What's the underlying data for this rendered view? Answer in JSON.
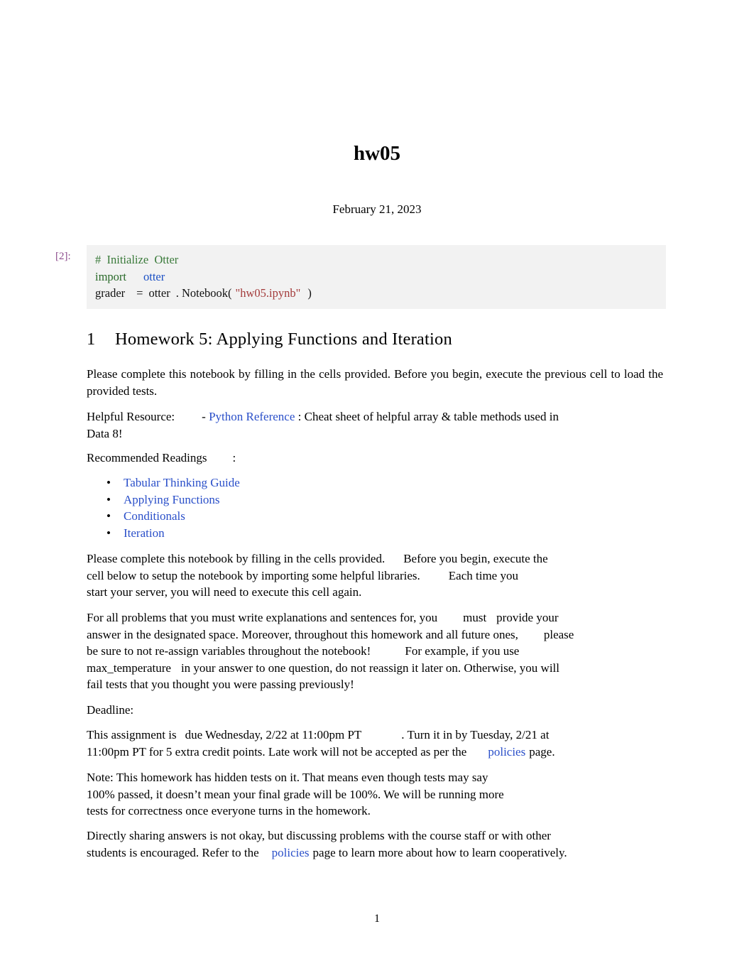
{
  "document": {
    "title": "hw05",
    "date": "February 21, 2023",
    "page_number": "1"
  },
  "code_cell": {
    "label": "[2]:",
    "lines": [
      {
        "comment": "#  Initialize  Otter"
      },
      {
        "kw": "import",
        "name": "otter"
      },
      {
        "plain1": "grader",
        "plain2": "=",
        "plain3": "otter",
        "plain4": ". Notebook(",
        "str": "\"hw05.ipynb\"",
        "plain5": ")"
      }
    ],
    "raw": "# Initialize Otter\nimport otter\ngrader = otter.Notebook(\"hw05.ipynb\")"
  },
  "section": {
    "number": "1",
    "heading": "Homework 5: Applying Functions and Iteration"
  },
  "paragraphs": {
    "p1": "Please complete this notebook by filling in the cells provided. Before you begin, execute the previous cell to load the provided tests.",
    "p2_lead": "Helpful  Resource:",
    "p2_dash": "-",
    "p2_link": "Python Reference",
    "p2_rest": ": Cheat sheet of helpful array & table methods used in",
    "p2_line2": "Data 8!",
    "p3_lead": "Recommended  Readings",
    "p3_colon": ":",
    "p4_line1": "Please  complete  this  notebook  by  filling  in  the  cells  provided.",
    "p4_line1b": "Before  you  begin,  execute  the",
    "p4_line2": "cell  below  to  setup  the  notebook  by  importing  some  helpful  libraries.",
    "p4_line2b": "Each  time  you",
    "p4_line3": "start your server, you will need to execute this cell again.",
    "p5_line1": "For  all  problems  that  you  must  write  explanations  and  sentences  for,  you",
    "p5_line1b": "must",
    "p5_line1c": "provide  your",
    "p5_line2": "answer in the designated space. Moreover, throughout this homework and all future ones,",
    "p5_line2b": "please",
    "p5_line3": "be  sure  to  not  re-assign  variables  throughout  the  notebook!",
    "p5_line3b": "For  example,  if  you  use",
    "p5_line4": "max_temperature",
    "p5_line4b": "in  your  answer  to  one  question,  do  not  reassign  it  later  on.  Otherwise,  you  will",
    "p5_line5": "fail tests that you thought you were passing previously!",
    "p6": "Deadline:",
    "p7_line1a": "This  assignment  is",
    "p7_line1b": "due Wednesday, 2/22 at 11:00pm PT",
    "p7_line1c": ". Turn it in by Tuesday, 2/21 at",
    "p7_line2a": "11:00pm PT for 5 extra credit points. Late work will not be accepted as per the",
    "p7_link": "policies",
    "p7_line2b": "page.",
    "p8_line1": "Note: This homework has hidden tests on it. That means even though tests may say",
    "p8_line2": "100% passed, it doesn’t mean your final grade will be 100%. We will be running more",
    "p8_line3": "tests for correctness once everyone turns in the homework.",
    "p9_line1": "Directly sharing answers is not okay, but discussing problems with the course staff or with other",
    "p9_line2a": "students is encouraged. Refer to the",
    "p9_link": "policies",
    "p9_line2b": "page to learn more about how to learn cooperatively."
  },
  "readings": [
    {
      "label": "Tabular Thinking Guide"
    },
    {
      "label": "Applying Functions"
    },
    {
      "label": "Conditionals"
    },
    {
      "label": "Iteration"
    }
  ],
  "colors": {
    "link": "#2a4fc9",
    "code_bg": "#f2f2f2",
    "cell_label": "#8b4a8b",
    "string": "#a33a3a",
    "comment": "#3a7a3a"
  }
}
